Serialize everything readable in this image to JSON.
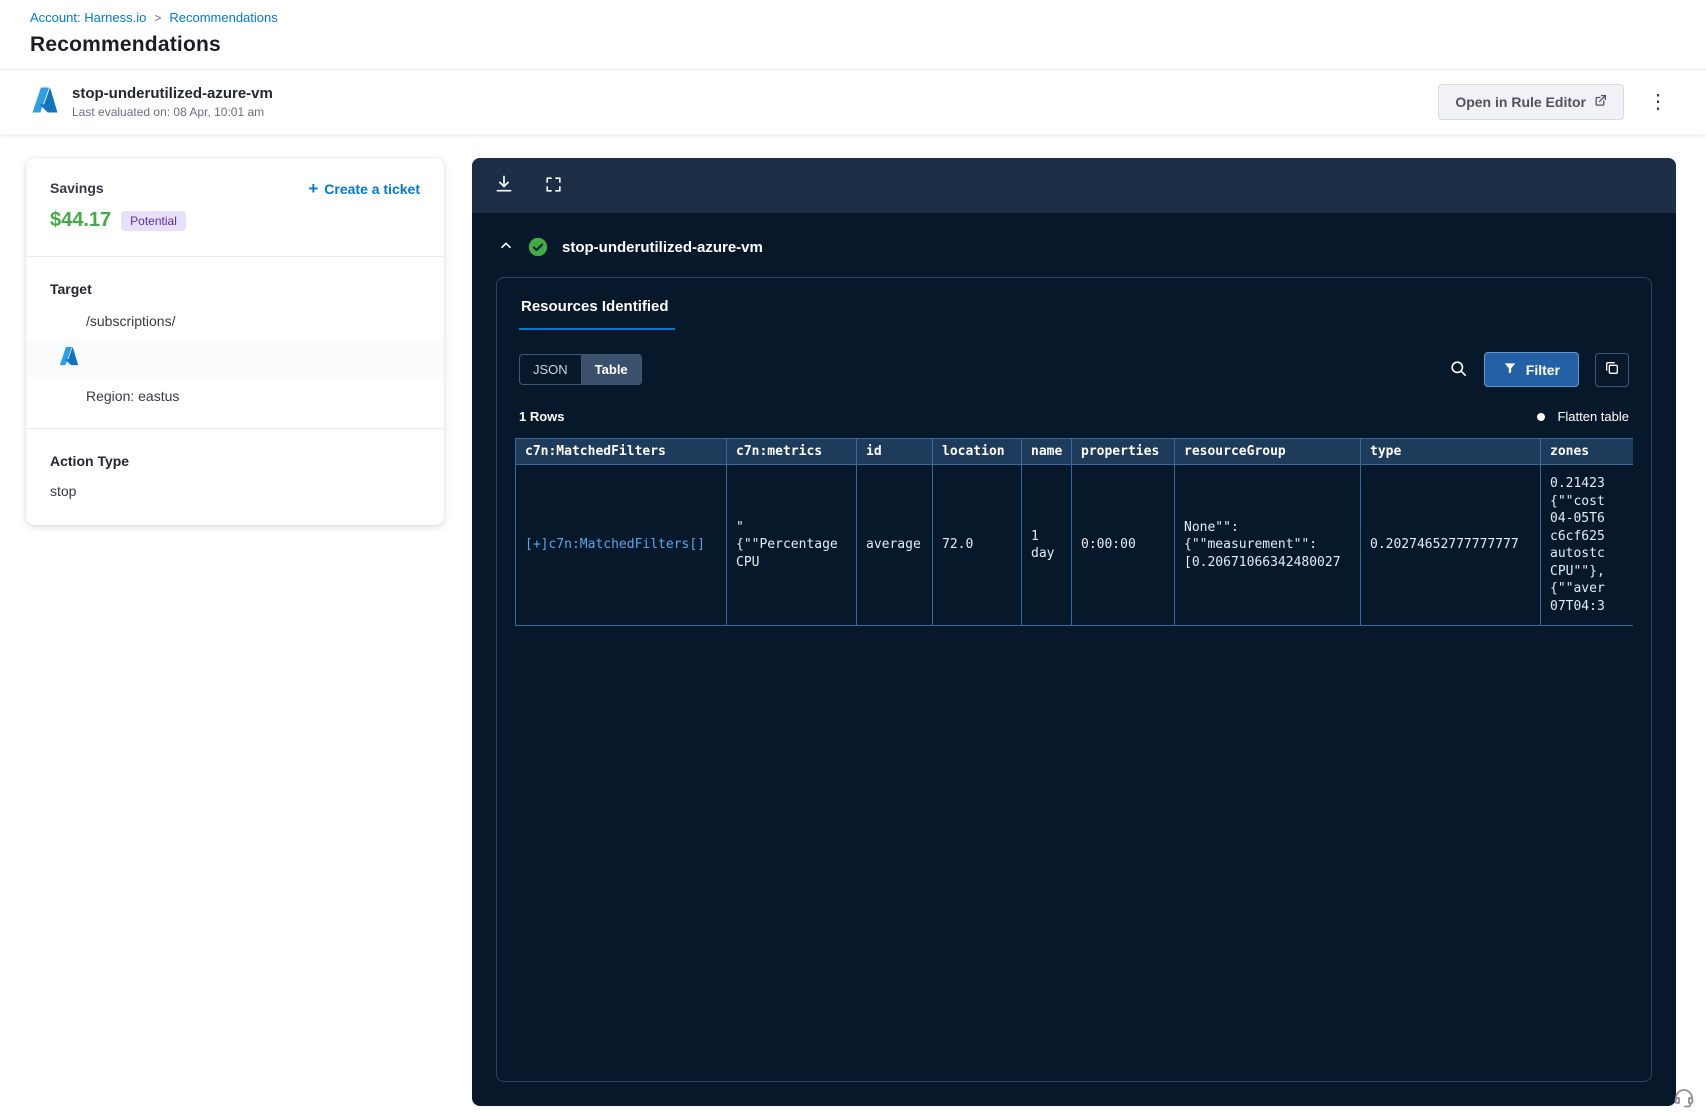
{
  "colors": {
    "accent_blue": "#0278d5",
    "savings_green": "#42ab45",
    "badge_purple_bg": "#e8e0fb",
    "badge_purple_text": "#592baa",
    "panel_navy": "#07182b",
    "toolbar_navy": "#1d2e47",
    "table_border_blue": "#39689c",
    "check_green": "#42ab45",
    "cell_link_blue": "#58a6e8"
  },
  "icons": {
    "plus": "+",
    "kebab": "⋮",
    "breadcrumb_separator": ">"
  },
  "breadcrumb": {
    "account": "Account: Harness.io",
    "current": "Recommendations"
  },
  "page_title": "Recommendations",
  "header": {
    "title": "stop-underutilized-azure-vm",
    "last_evaluated": "Last evaluated on: 08 Apr, 10:01 am",
    "open_rule_editor_label": "Open in Rule Editor"
  },
  "summary_card": {
    "savings_label": "Savings",
    "savings_amount": "$44.17",
    "savings_badge": "Potential",
    "create_ticket_label": "Create a ticket",
    "target_label": "Target",
    "target_path": "/subscriptions/",
    "target_region": "Region: eastus",
    "action_type_label": "Action Type",
    "action_type_value": "stop"
  },
  "resource_panel": {
    "title": "stop-underutilized-azure-vm",
    "tab_label": "Resources Identified",
    "view_json_label": "JSON",
    "view_table_label": "Table",
    "filter_label": "Filter",
    "rows_count": "1 Rows",
    "flatten_label": "Flatten table",
    "table": {
      "headers": [
        "c7n:MatchedFilters",
        "c7n:metrics",
        "id",
        "location",
        "name",
        "properties",
        "resourceGroup",
        "type",
        "zones"
      ],
      "row": [
        "[+]c7n:MatchedFilters[]",
        "\"\n{\"\"Percentage\nCPU",
        "average",
        "72.0",
        "1\nday",
        "0:00:00",
        "None\"\":\n{\"\"measurement\"\":\n[0.20671066342480027",
        "0.20274652777777777",
        "0.21423\n{\"\"cost\n04-05T6\nc6cf625\nautostc\nCPU\"\"},\n{\"\"aver\n07T04:3"
      ]
    }
  }
}
